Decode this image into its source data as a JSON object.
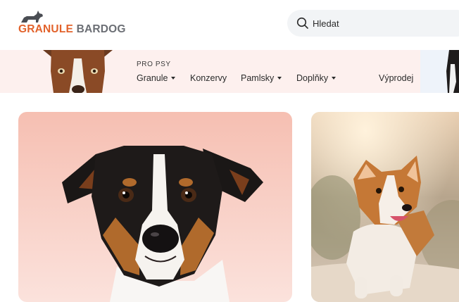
{
  "header": {
    "logo": {
      "part1": "GRANULE",
      "part2": "BARDOG"
    },
    "search": {
      "placeholder": "Hledat"
    }
  },
  "nav": {
    "section_label": "PRO PSY",
    "items": [
      {
        "label": "Granule",
        "has_dropdown": true
      },
      {
        "label": "Konzervy",
        "has_dropdown": false
      },
      {
        "label": "Pamlsky",
        "has_dropdown": true
      },
      {
        "label": "Doplňky",
        "has_dropdown": true
      },
      {
        "label": "Výprodej",
        "has_dropdown": false
      }
    ]
  },
  "cards": [
    {
      "image": "jack-russell-terrier-photo"
    },
    {
      "image": "corgi-running-photo"
    }
  ],
  "colors": {
    "brand_orange": "#e2622b",
    "brand_gray": "#6b6e74",
    "nav_band": "#fdf0ee",
    "search_bg": "#f2f4f6"
  }
}
